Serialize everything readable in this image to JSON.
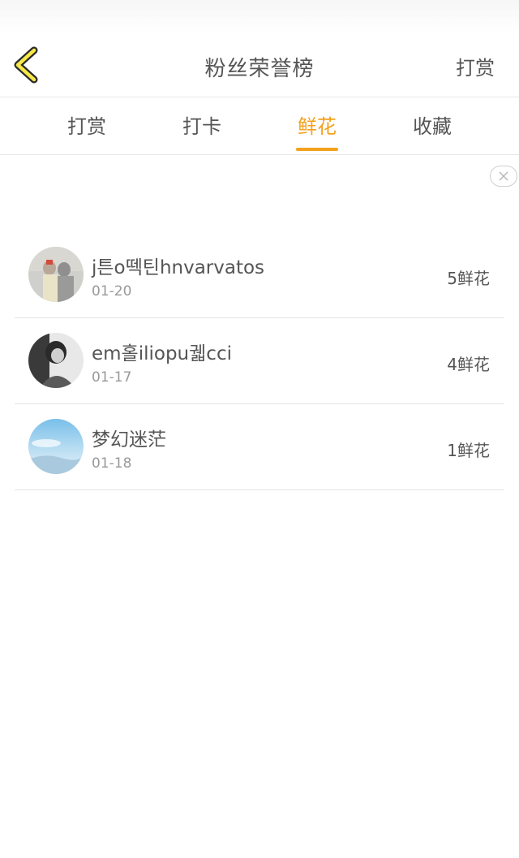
{
  "header": {
    "title": "粉丝荣誉榜",
    "action_label": "打赏"
  },
  "tabs": [
    {
      "label": "打赏",
      "active": false
    },
    {
      "label": "打卡",
      "active": false
    },
    {
      "label": "鲜花",
      "active": true
    },
    {
      "label": "收藏",
      "active": false
    }
  ],
  "accent_color": "#f3a21d",
  "icons": {
    "back": "chevron-left-icon",
    "close": "close-icon"
  },
  "list": [
    {
      "name": "j튼o떽틴hnvarvatos",
      "date": "01-20",
      "count": "5鲜花"
    },
    {
      "name": "em홀iliopu궯cci",
      "date": "01-17",
      "count": "4鲜花"
    },
    {
      "name": "梦幻迷茫",
      "date": "01-18",
      "count": "1鲜花"
    }
  ]
}
